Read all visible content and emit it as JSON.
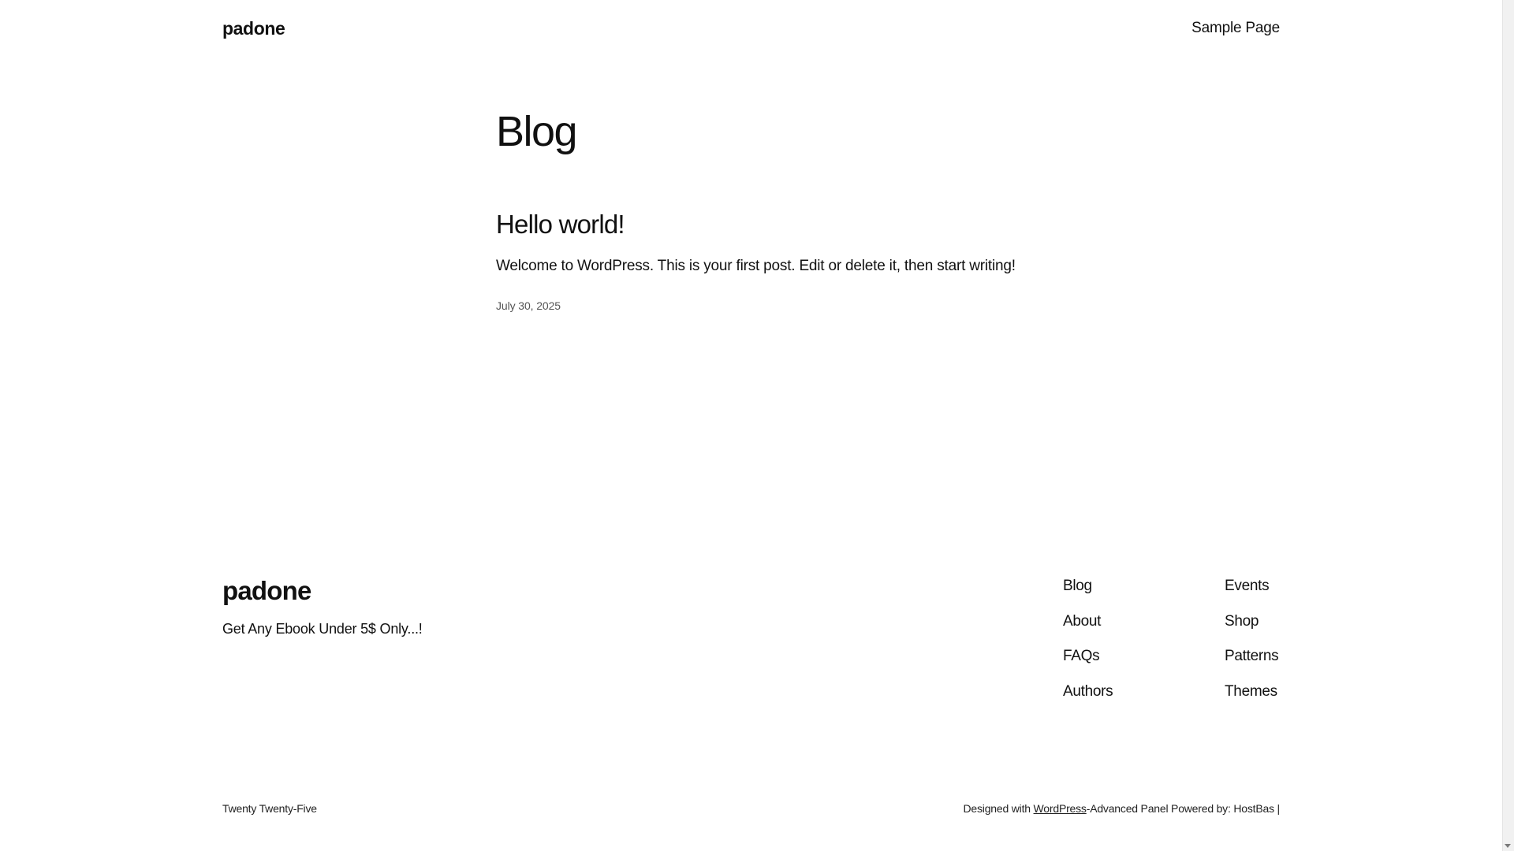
{
  "header": {
    "site_title": "padone",
    "nav": [
      "Sample Page"
    ]
  },
  "main": {
    "heading": "Blog",
    "posts": [
      {
        "title": "Hello world!",
        "excerpt": "Welcome to WordPress. This is your first post. Edit or delete it, then start writing!",
        "date": "July 30, 2025"
      }
    ]
  },
  "footer": {
    "site_title": "padone",
    "tagline": "Get Any Ebook Under 5$ Only...!",
    "nav_col_1": [
      "Blog",
      "About",
      "FAQs",
      "Authors"
    ],
    "nav_col_2": [
      "Events",
      "Shop",
      "Patterns",
      "Themes"
    ],
    "theme_name": "Twenty Twenty-Five",
    "credit": {
      "prefix": "Designed with ",
      "link": "WordPress",
      "suffix": "-Advanced Panel Powered by: HostBas |"
    }
  },
  "icons": {
    "scroll_down": "chevron-down-icon"
  }
}
